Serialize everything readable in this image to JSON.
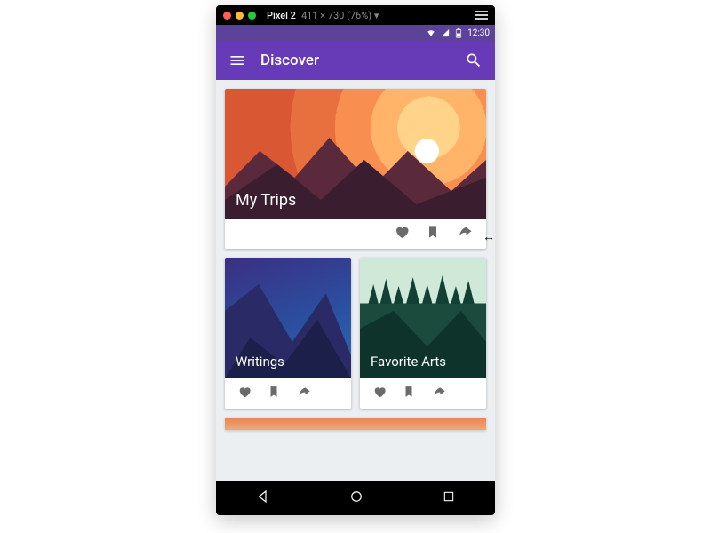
{
  "devtools": {
    "device_label": "Pixel 2",
    "dimensions": "411 × 730 (76%) ▾"
  },
  "status": {
    "time": "12:30"
  },
  "appbar": {
    "title": "Discover"
  },
  "cards": {
    "big": {
      "title": "My Trips"
    },
    "small": [
      {
        "title": "Writings"
      },
      {
        "title": "Favorite Arts"
      }
    ]
  },
  "icons": {
    "heart": "heart-icon",
    "bookmark": "bookmark-icon",
    "share": "share-icon"
  }
}
